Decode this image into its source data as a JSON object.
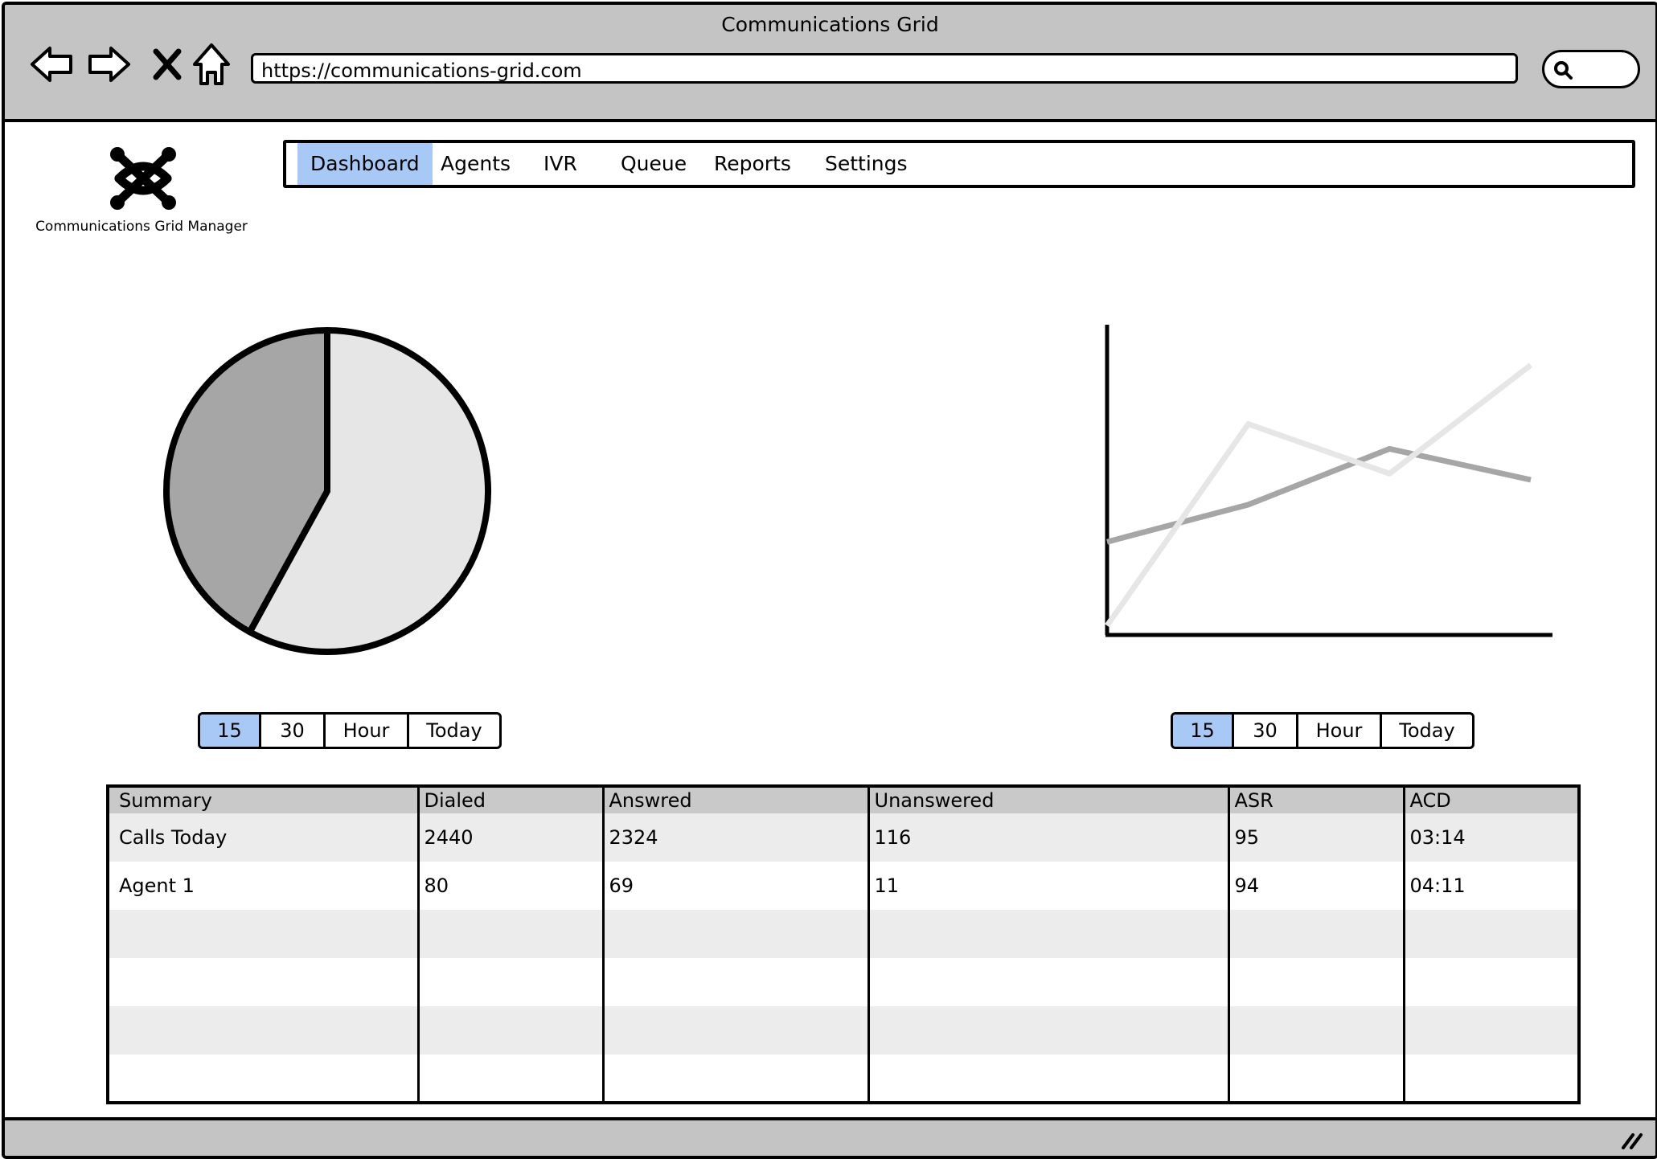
{
  "browser": {
    "title": "Communications Grid",
    "url": "https://communications-grid.com",
    "nav_icons": [
      "back-arrow-icon",
      "forward-arrow-icon",
      "close-icon",
      "home-icon"
    ],
    "search_icon": "search-icon"
  },
  "app": {
    "logo_icon": "joomla-knot-logo",
    "caption": "Communications Grid Manager"
  },
  "menu": {
    "items": [
      {
        "label": "Dashboard",
        "active": true
      },
      {
        "label": "Agents",
        "active": false
      },
      {
        "label": "IVR",
        "active": false
      },
      {
        "label": "Queue",
        "active": false
      },
      {
        "label": "Reports",
        "active": false
      },
      {
        "label": "Settings",
        "active": false
      }
    ]
  },
  "ranges": {
    "left": [
      {
        "label": "15",
        "active": true
      },
      {
        "label": "30",
        "active": false
      },
      {
        "label": "Hour",
        "active": false
      },
      {
        "label": "Today",
        "active": false
      }
    ],
    "right": [
      {
        "label": "15",
        "active": true
      },
      {
        "label": "30",
        "active": false
      },
      {
        "label": "Hour",
        "active": false
      },
      {
        "label": "Today",
        "active": false
      }
    ]
  },
  "chart_data": [
    {
      "type": "pie",
      "values": [
        58,
        42
      ],
      "colors": [
        "#e6e6e6",
        "#a6a6a6"
      ]
    },
    {
      "type": "line",
      "x": [
        0,
        1,
        2,
        3
      ],
      "series": [
        {
          "values": [
            30,
            42,
            60,
            50
          ],
          "color": "#a6a6a6"
        },
        {
          "values": [
            3,
            68,
            52,
            87
          ],
          "color": "#e6e6e6"
        }
      ],
      "ylim": [
        0,
        100
      ]
    }
  ],
  "table": {
    "headers": [
      "Summary",
      "Dialed",
      "Answred",
      "Unanswered",
      "ASR",
      "ACD"
    ],
    "rows": [
      [
        "Calls Today",
        "2440",
        "2324",
        "116",
        "95",
        "03:14"
      ],
      [
        "Agent 1",
        "80",
        "69",
        "11",
        "94",
        "04:11"
      ],
      [
        "",
        "",
        "",
        "",
        "",
        ""
      ],
      [
        "",
        "",
        "",
        "",
        "",
        ""
      ],
      [
        "",
        "",
        "",
        "",
        "",
        ""
      ],
      [
        "",
        "",
        "",
        "",
        "",
        ""
      ]
    ]
  },
  "statusbar": {
    "resize_icon": "resize-grip-icon"
  }
}
